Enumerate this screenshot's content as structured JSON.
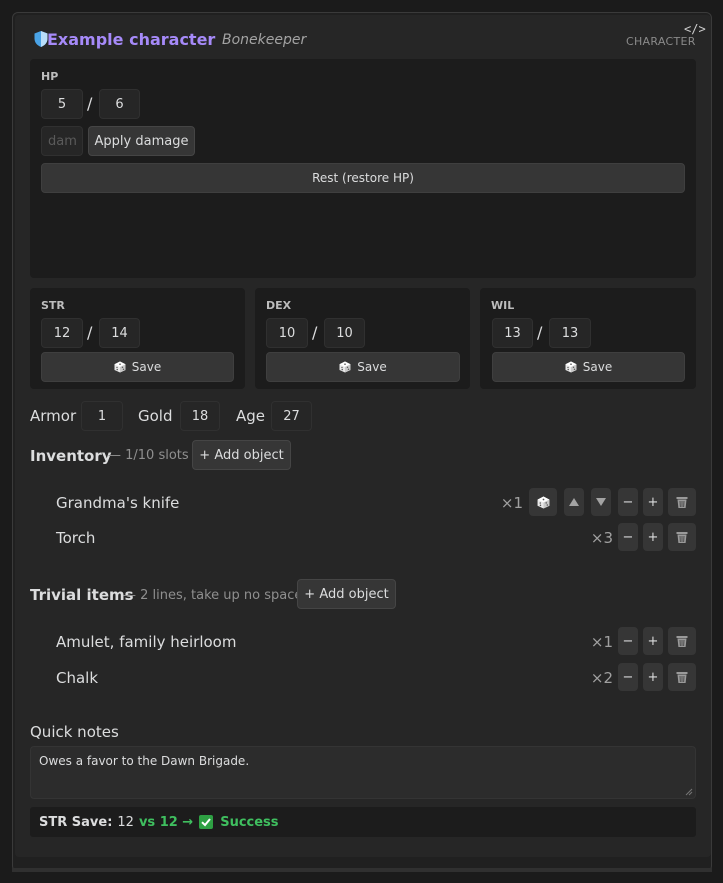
{
  "header": {
    "name": "Example character",
    "subtitle": "Bonekeeper",
    "type_label": "CHARACTER",
    "code_icon": "</>"
  },
  "hp": {
    "label": "HP",
    "current": "5",
    "max": "6",
    "separator": "/",
    "damage_placeholder": "dam",
    "apply_label": "Apply damage",
    "rest_label": "Rest (restore HP)"
  },
  "attributes": [
    {
      "label": "STR",
      "current": "12",
      "max": "14",
      "save_label": "Save"
    },
    {
      "label": "DEX",
      "current": "10",
      "max": "10",
      "save_label": "Save"
    },
    {
      "label": "WIL",
      "current": "13",
      "max": "13",
      "save_label": "Save"
    }
  ],
  "stats": {
    "armor_label": "Armor",
    "armor": "1",
    "gold_label": "Gold",
    "gold": "18",
    "age_label": "Age",
    "age": "27"
  },
  "inventory": {
    "title": "Inventory",
    "subtitle": "— 1/10 slots",
    "add_label": "+ Add object",
    "items": [
      {
        "name": "Grandma's knife",
        "qty": "×1"
      },
      {
        "name": "Torch",
        "qty": "×3"
      }
    ]
  },
  "trivial": {
    "title": "Trivial items",
    "subtitle": "— 2 lines, take up no space",
    "add_label": "+ Add object",
    "items": [
      {
        "name": "Amulet, family heirloom",
        "qty": "×1"
      },
      {
        "name": "Chalk",
        "qty": "×2"
      }
    ]
  },
  "controls": {
    "minus": "−",
    "plus": "+"
  },
  "notes": {
    "label": "Quick notes",
    "text": "Owes a favor to the Dawn Brigade."
  },
  "result": {
    "label": "STR Save:",
    "roll": "12",
    "vs": "vs 12 →",
    "outcome": "Success"
  },
  "colors": {
    "accent": "#a68af9",
    "success": "#3fbf5f",
    "background": "#262626",
    "panel": "#1c1c1c"
  },
  "icons": {
    "header": "shield-icon",
    "save": "dice-icon",
    "delete": "trash-icon",
    "move_up": "arrow-up-icon",
    "move_down": "arrow-down-icon",
    "code": "code-icon",
    "result": "check-icon"
  }
}
